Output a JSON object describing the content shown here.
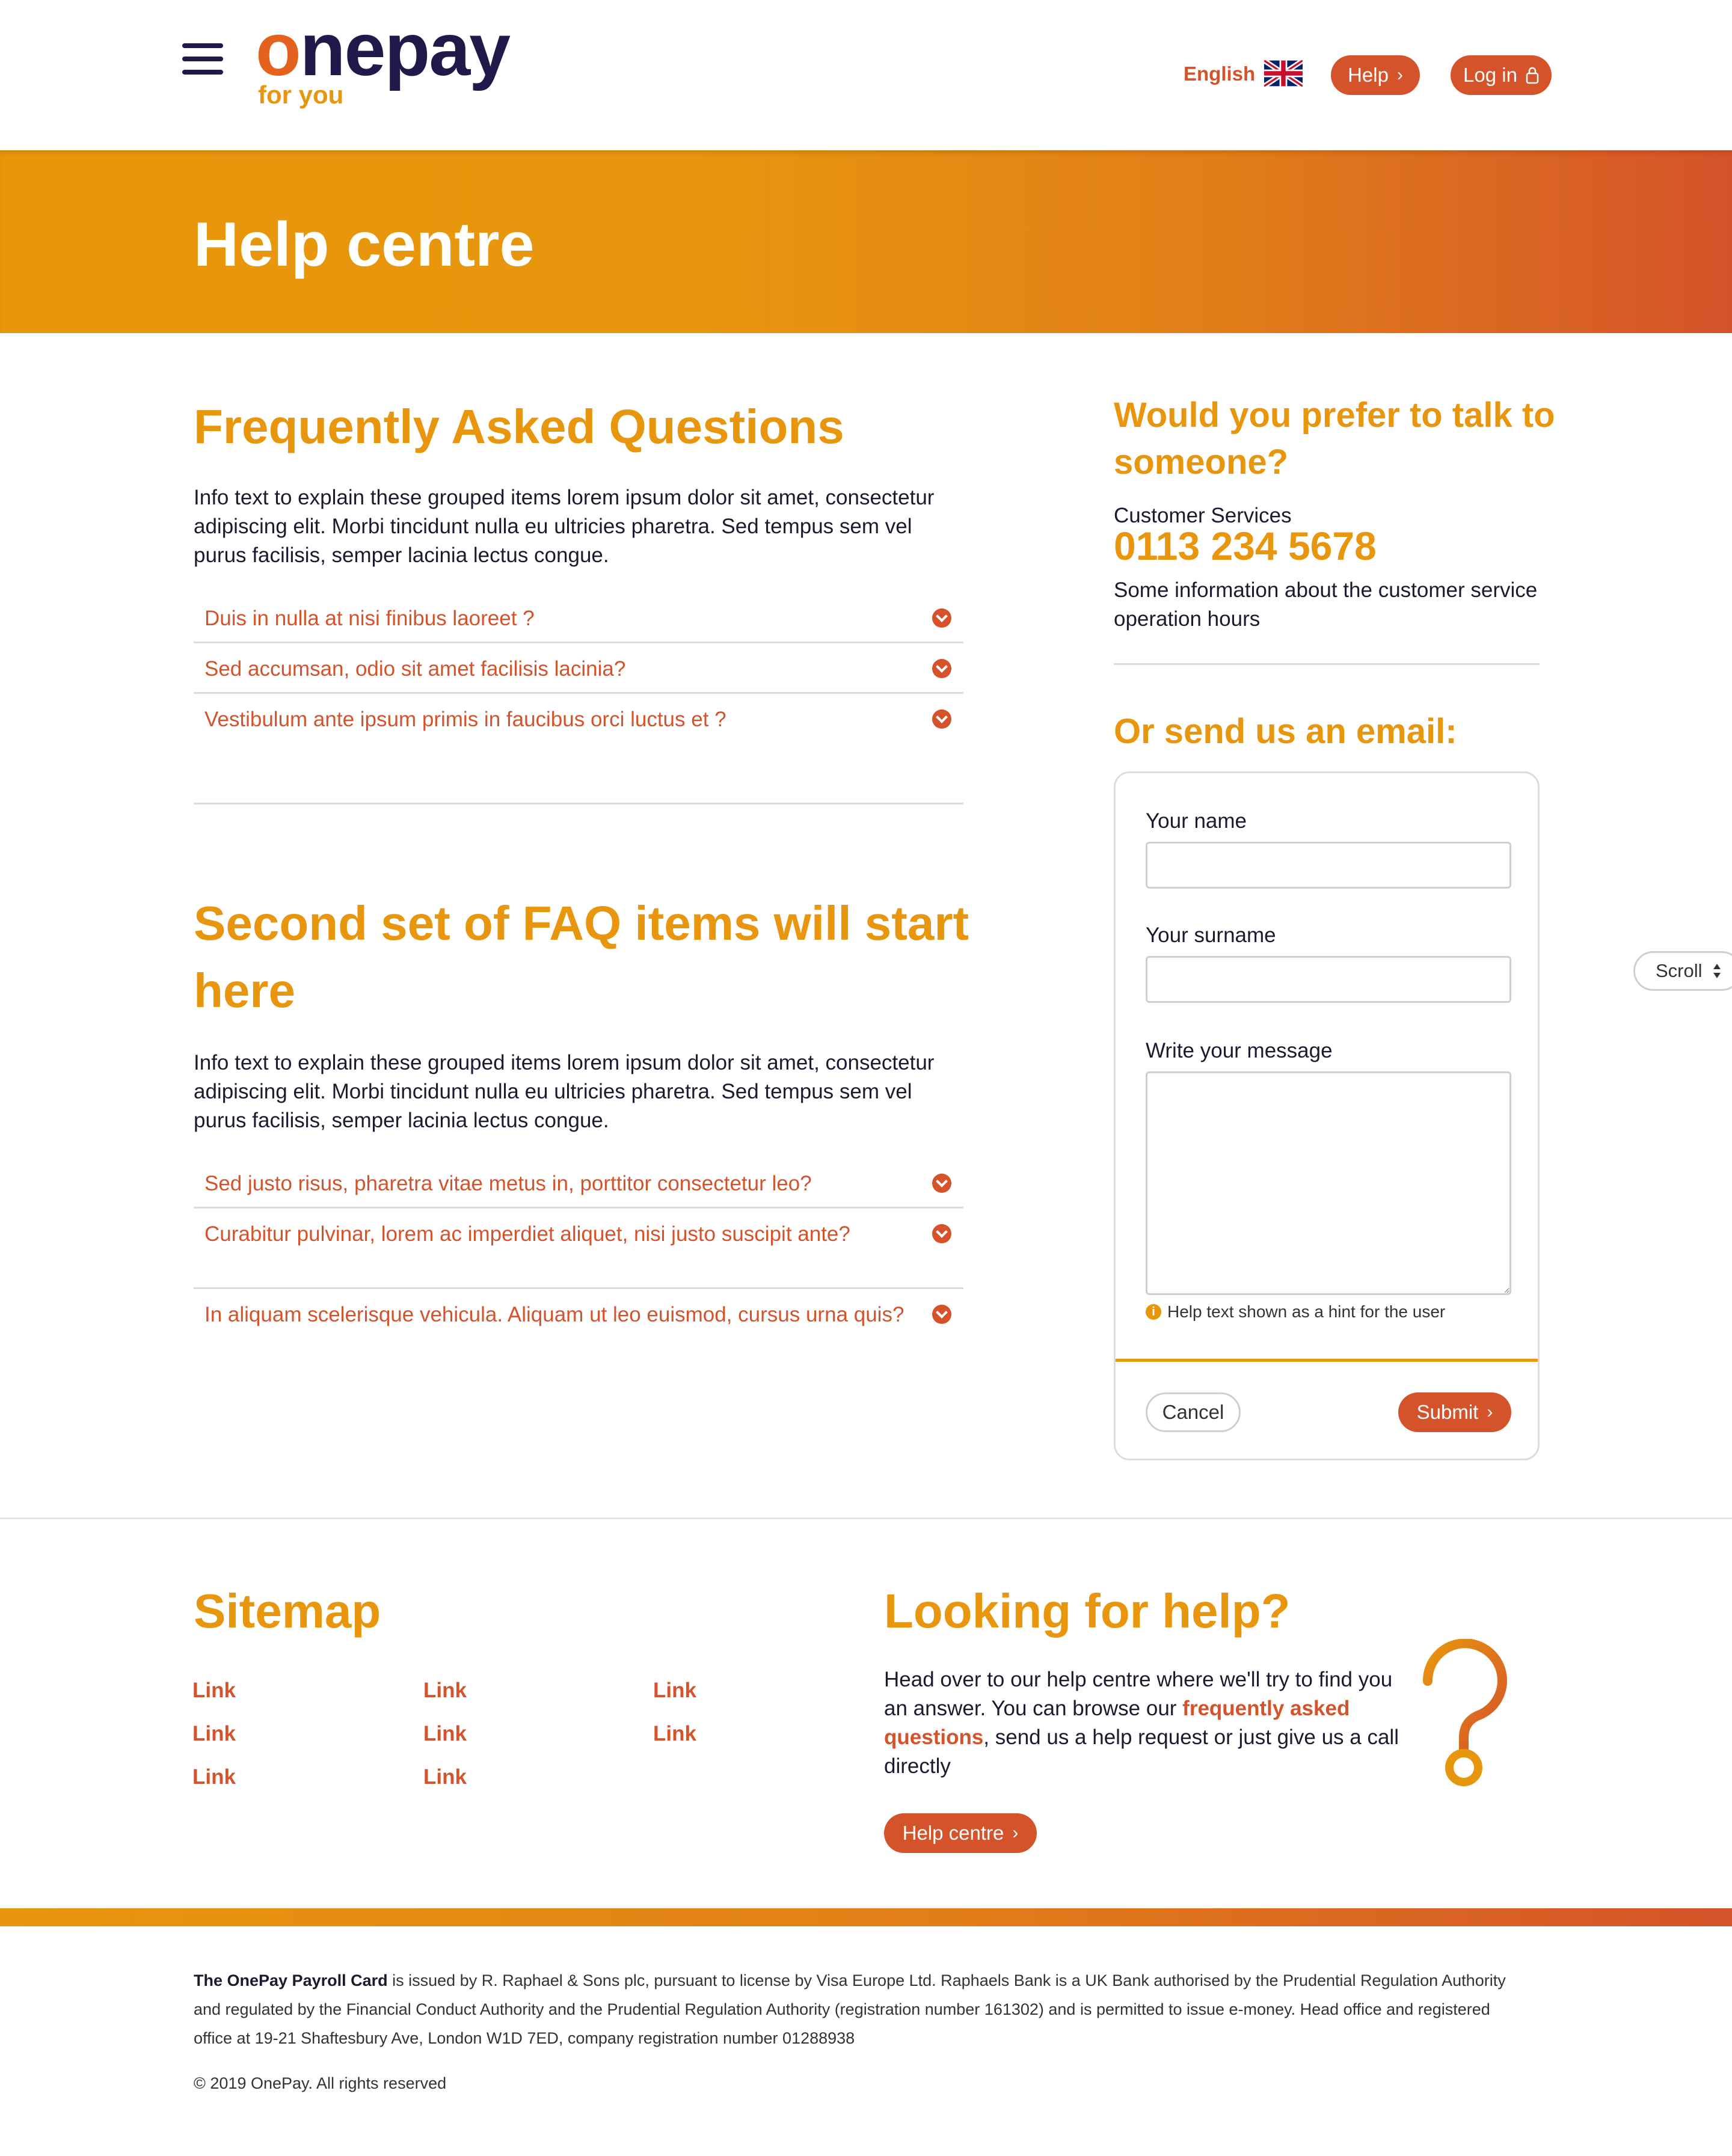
{
  "header": {
    "logo_main_o": "o",
    "logo_main_rest": "nepay",
    "logo_sub": "for you",
    "language": "English",
    "help_button": "Help",
    "login_button": "Log in"
  },
  "banner": {
    "title": "Help centre"
  },
  "faq1": {
    "title": "Frequently Asked Questions",
    "intro": "Info text to explain these grouped items lorem ipsum dolor sit amet, consectetur adipiscing elit. Morbi tincidunt nulla eu ultricies pharetra. Sed tempus sem vel purus facilisis, semper lacinia lectus congue.",
    "items": [
      "Duis in nulla at nisi finibus laoreet ?",
      "Sed accumsan, odio sit amet facilisis lacinia?",
      "Vestibulum ante ipsum primis in faucibus orci luctus et ?"
    ]
  },
  "faq2": {
    "title": "Second set of FAQ items will start here",
    "intro": "Info text to explain these grouped items lorem ipsum dolor sit amet, consectetur adipiscing elit. Morbi tincidunt nulla eu ultricies pharetra. Sed tempus sem vel purus facilisis, semper lacinia lectus congue.",
    "items": [
      "Sed justo risus, pharetra vitae metus in, porttitor consectetur leo?",
      "Curabitur pulvinar, lorem ac imperdiet aliquet, nisi justo suscipit ante?",
      "In aliquam scelerisque vehicula. Aliquam ut leo euismod, cursus urna quis?"
    ]
  },
  "contact": {
    "title": "Would you prefer to talk to someone?",
    "label": "Customer Services",
    "phone": "0113 234 5678",
    "hours": "Some information about the customer service operation hours",
    "email_title": "Or send us an email:"
  },
  "form": {
    "name_label": "Your name",
    "surname_label": "Your surname",
    "message_label": "Write your message",
    "hint": "Help text shown as a hint for the user",
    "cancel": "Cancel",
    "submit": "Submit"
  },
  "scroll_tab": "Scroll",
  "sitemap": {
    "title": "Sitemap",
    "links": [
      "Link",
      "Link",
      "Link",
      "Link",
      "Link",
      "Link",
      "Link",
      "Link"
    ]
  },
  "help_promo": {
    "title": "Looking for help?",
    "text_before": "Head over to our help centre where we'll try to find you an answer. You can browse our ",
    "link_text": "frequently asked questions",
    "text_after": ", send us a help request or just give us a call directly",
    "button": "Help centre"
  },
  "footer": {
    "legal_bold": "The OnePay Payroll Card",
    "legal_text": " is issued by R. Raphael & Sons plc, pursuant to license by Visa Europe Ltd. Raphaels Bank is a UK Bank authorised by the Prudential Regulation Authority and regulated by the Financial Conduct Authority and the Prudential Regulation Authority (registration number 161302) and is permitted to issue e-money. Head office and registered office at 19-21 Shaftesbury Ave, London W1D 7ED, company registration number 01288938",
    "copyright": "© 2019 OnePay. All rights reserved"
  },
  "colors": {
    "primary_orange": "#e8960e",
    "accent_red": "#d4532a",
    "navy": "#22194a"
  },
  "icons": [
    "menu-icon",
    "uk-flag-icon",
    "chevron-right-icon",
    "lock-icon",
    "chevron-down-circle-icon",
    "info-icon",
    "question-mark-icon",
    "sort-icon"
  ]
}
